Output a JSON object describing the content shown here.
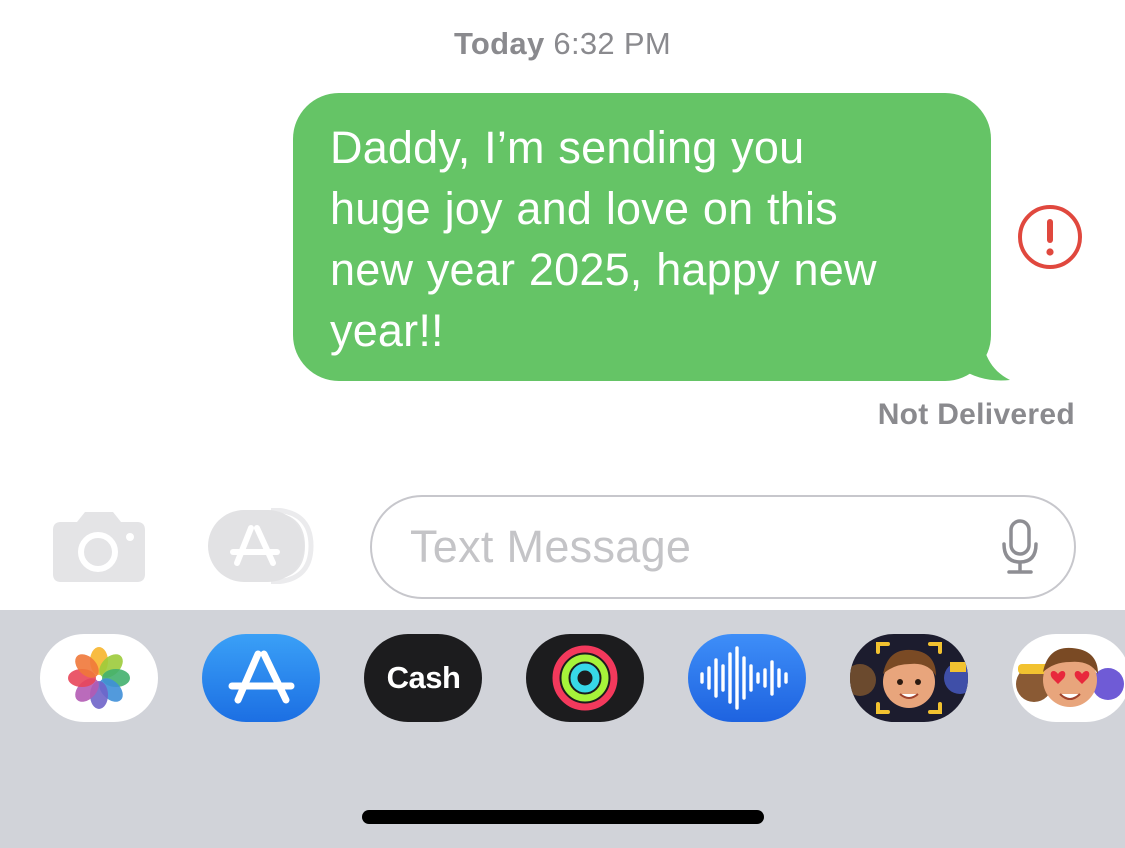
{
  "header": {
    "timestamp_day": "Today",
    "timestamp_time": "6:32 PM"
  },
  "message": {
    "lines": [
      "Daddy, I’m sending you",
      "huge joy and love on this",
      "new year 2025, happy new",
      "year!!"
    ],
    "status": "Not Delivered",
    "bubble_color": "#65c466",
    "error_color": "#e0483e"
  },
  "composer": {
    "placeholder": "Text Message",
    "camera_icon": "camera-icon",
    "apps_icon": "app-store-icon",
    "mic_icon": "microphone-icon"
  },
  "app_tray": {
    "items": [
      {
        "name": "photos",
        "icon": "photos-icon"
      },
      {
        "name": "app-store",
        "icon": "app-store-icon"
      },
      {
        "name": "apple-cash",
        "icon": "apple-cash-icon",
        "label": "Cash",
        "logo": ""
      },
      {
        "name": "fitness",
        "icon": "activity-rings-icon"
      },
      {
        "name": "audio-message",
        "icon": "waveform-icon"
      },
      {
        "name": "memoji",
        "icon": "memoji-camera-icon"
      },
      {
        "name": "memoji-stickers",
        "icon": "memoji-stickers-icon"
      }
    ]
  }
}
